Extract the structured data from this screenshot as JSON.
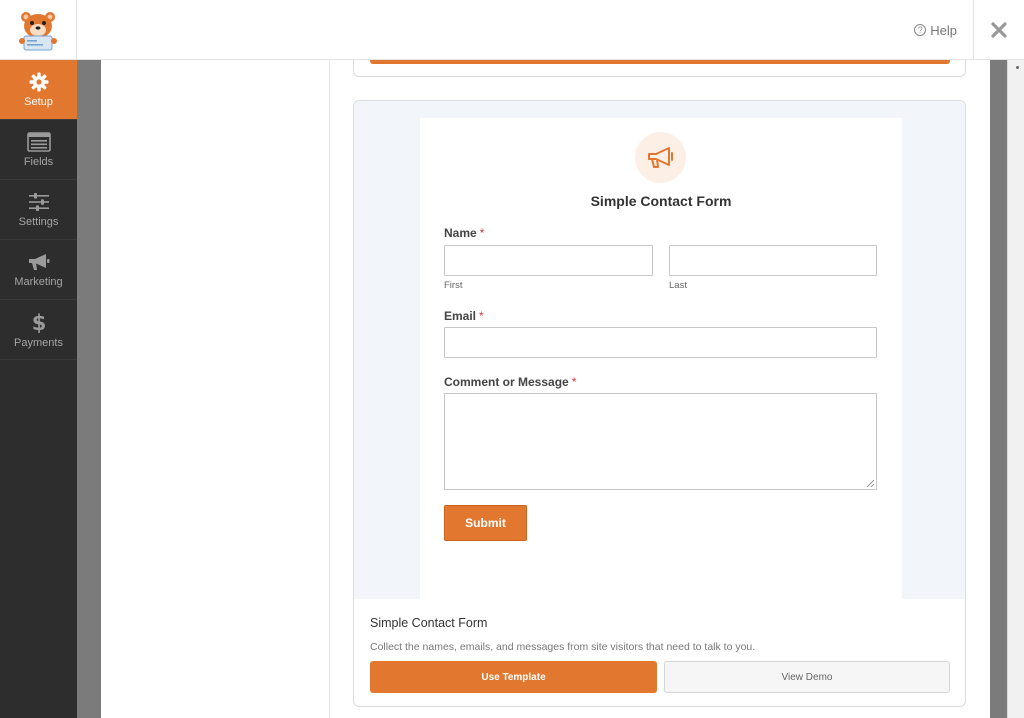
{
  "header": {
    "help_label": "Help",
    "help_icon": "question-circle-icon",
    "close_icon": "close-icon",
    "logo_icon": "wpforms-bear-logo"
  },
  "sidebar": {
    "items": [
      {
        "label": "Setup",
        "icon": "gear-icon",
        "active": true
      },
      {
        "label": "Fields",
        "icon": "fields-list-icon",
        "active": false
      },
      {
        "label": "Settings",
        "icon": "sliders-icon",
        "active": false
      },
      {
        "label": "Marketing",
        "icon": "megaphone-icon",
        "active": false
      },
      {
        "label": "Payments",
        "icon": "dollar-icon",
        "active": false
      }
    ]
  },
  "template": {
    "form_title": "Simple Contact Form",
    "form_icon": "megaphone-icon",
    "fields": {
      "name_label": "Name",
      "first_sublabel": "First",
      "last_sublabel": "Last",
      "email_label": "Email",
      "message_label": "Comment or Message",
      "required_mark": "*"
    },
    "submit_label": "Submit",
    "card_name": "Simple Contact Form",
    "card_description": "Collect the names, emails, and messages from site visitors that need to talk to you.",
    "use_template_label": "Use Template",
    "view_demo_label": "View Demo"
  },
  "colors": {
    "accent": "#e27730",
    "sidebar_bg": "#2d2d2d",
    "preview_bg": "#f2f5fa"
  }
}
